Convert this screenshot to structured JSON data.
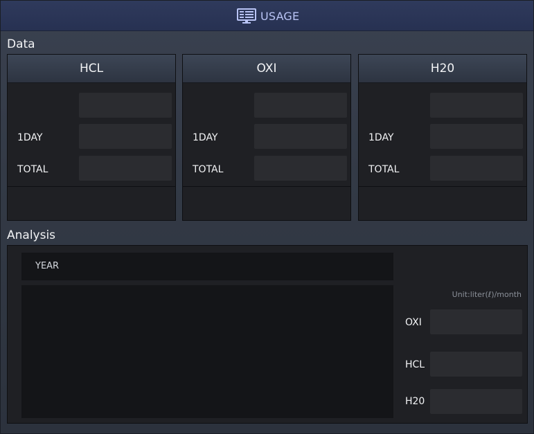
{
  "window": {
    "title": "USAGE",
    "title_icon": "monitor-icon",
    "accent": "#b9c4f5"
  },
  "sections": {
    "data": "Data",
    "analysis": "Analysis"
  },
  "panels": [
    {
      "name": "HCL",
      "rows": [
        {
          "label": ""
        },
        {
          "label": "1DAY"
        },
        {
          "label": "TOTAL"
        }
      ]
    },
    {
      "name": "OXI",
      "rows": [
        {
          "label": ""
        },
        {
          "label": "1DAY"
        },
        {
          "label": "TOTAL"
        }
      ]
    },
    {
      "name": "H20",
      "rows": [
        {
          "label": ""
        },
        {
          "label": "1DAY"
        },
        {
          "label": "TOTAL"
        }
      ]
    }
  ],
  "analysis": {
    "year_label": "YEAR",
    "unit": "Unit:liter(ℓ)/month",
    "items": [
      {
        "label": "OXI"
      },
      {
        "label": "HCL"
      },
      {
        "label": "H20"
      }
    ]
  }
}
